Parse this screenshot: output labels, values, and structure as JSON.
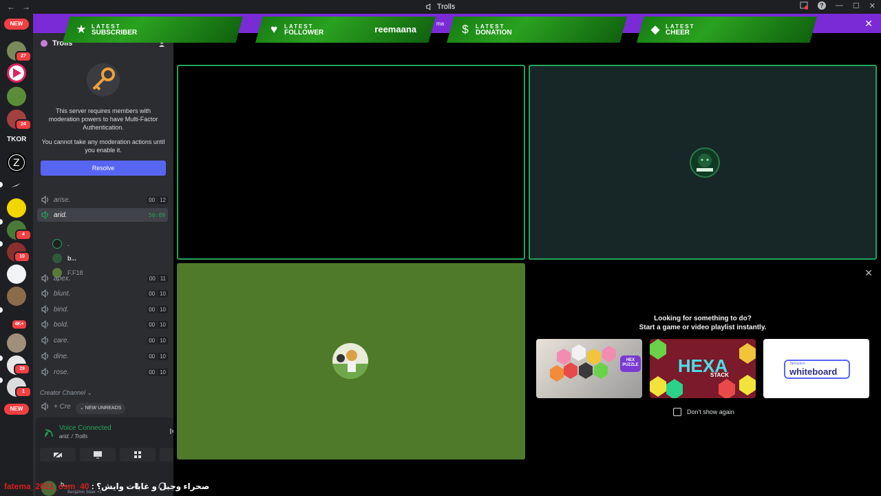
{
  "window": {
    "title": "Trolls",
    "back": "←",
    "forward": "→",
    "help": "?",
    "minimize": "—",
    "maximize": "☐",
    "close": "✕"
  },
  "server_list": {
    "new_label_top": "NEW",
    "new_label_bottom": "NEW",
    "tkor_label": "TKOR",
    "badges": [
      "27",
      "24",
      "4",
      "10",
      "4K+",
      "29",
      "1"
    ]
  },
  "sidebar": {
    "server_name": "Trolls",
    "mfa_notice": {
      "line1": "This server requires members with moderation powers to have Multi-Factor Authentication.",
      "line2": "You cannot take any moderation actions until you enable it.",
      "resolve_label": "Resolve"
    },
    "channels": [
      {
        "name": "arise.",
        "count_a": "00",
        "count_b": "12"
      },
      {
        "name": "arid.",
        "timer": "56:09"
      },
      {
        "name": "apex.",
        "count_a": "00",
        "count_b": "11"
      },
      {
        "name": "blunt.",
        "count_a": "00",
        "count_b": "10"
      },
      {
        "name": "bind.",
        "count_a": "00",
        "count_b": "10"
      },
      {
        "name": "bold.",
        "count_a": "00",
        "count_b": "10"
      },
      {
        "name": "care.",
        "count_a": "00",
        "count_b": "10"
      },
      {
        "name": "dine.",
        "count_a": "00",
        "count_b": "10"
      },
      {
        "name": "rose.",
        "count_a": "00",
        "count_b": "10"
      }
    ],
    "members": [
      ".",
      "b...",
      "F.F18"
    ],
    "category_label": "Creator Channel ⌄",
    "create_label": "+ Cre",
    "new_unreads": "⌄ NEW UNREADS"
  },
  "voice_panel": {
    "status": "Voice Connected",
    "channel": "arid. / Trolls"
  },
  "user_panel": {
    "name": "b...",
    "activity": "Benjamin Steer +1"
  },
  "stream_alerts": {
    "fragment": "ma",
    "cards": [
      {
        "top": "LATEST",
        "bottom": "SUBSCRIBER",
        "icon": "★",
        "name": ""
      },
      {
        "top": "LATEST",
        "bottom": "FOLLOWER",
        "icon": "♥",
        "name": "reemaana"
      },
      {
        "top": "LATEST",
        "bottom": "DONATION",
        "icon": "$",
        "name": ""
      },
      {
        "top": "LATEST",
        "bottom": "CHEER",
        "icon": "◆",
        "name": ""
      }
    ]
  },
  "activity_shelf": {
    "line1": "Looking for something to do?",
    "line2": "Start a game or video playlist instantly.",
    "dont_show": "Don't show again",
    "cards": [
      {
        "title": "HEX PUZZLE"
      },
      {
        "title": "HEXA",
        "subtitle": "STACK"
      },
      {
        "title": "whiteboard",
        "subtitle": "Jamspace"
      }
    ]
  },
  "overlay_chat": {
    "nick": "fatema_2021_osm_40",
    "message": "صحراء وجبل و غابات وايش؟ :"
  },
  "colors": {
    "accent": "#5865f2",
    "speaking": "#23a55a",
    "alert_bar": "#7a2bd6",
    "alert_card": "#2aa120"
  }
}
